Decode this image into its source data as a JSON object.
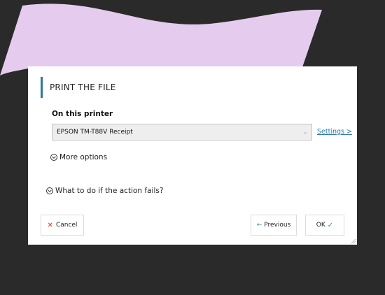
{
  "colors": {
    "background": "#2a2a2a",
    "shape": "#e5ccef",
    "accent": "#2b7a9b",
    "link": "#2b7ab0",
    "cancel": "#d9342b",
    "ok_check": "#3aa757"
  },
  "dialog": {
    "title": "PRINT THE FILE",
    "printer_label": "On this printer",
    "printer_select": {
      "value": "EPSON TM-T88V Receipt",
      "icon": "chevron-down-icon"
    },
    "settings_link": "Settings >",
    "more_options": "More options",
    "fail_options": "What to do if the action fails?",
    "buttons": {
      "cancel": {
        "icon": "close-icon",
        "label": "Cancel"
      },
      "previous": {
        "icon": "arrow-left-icon",
        "label": "Previous"
      },
      "ok": {
        "label": "OK",
        "icon": "check-icon"
      }
    }
  }
}
